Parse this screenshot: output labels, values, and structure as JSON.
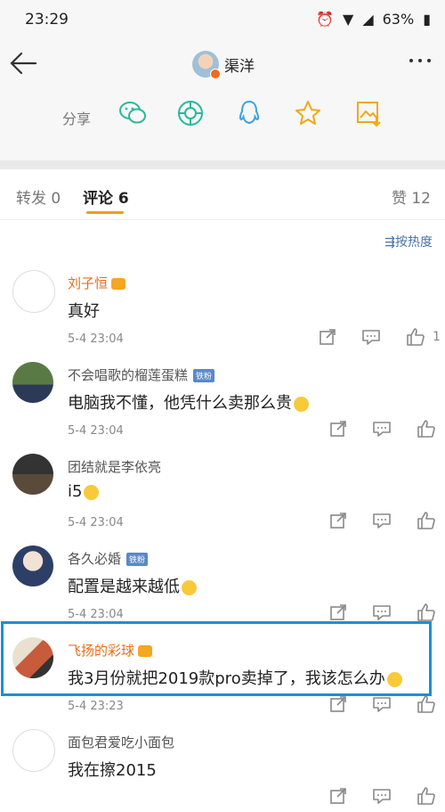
{
  "status": {
    "time": "23:29",
    "battery": "63%"
  },
  "header": {
    "title": "渠洋"
  },
  "share": {
    "label": "分享"
  },
  "tabs": {
    "repost": "转发 0",
    "comment": "评论 6",
    "likes": "赞 12"
  },
  "sort": {
    "label": "按热度"
  },
  "comments": [
    {
      "name": "刘子恒",
      "text": "真好",
      "time": "5-4 23:04",
      "likes": "1"
    },
    {
      "name": "不会唱歌的榴莲蛋糕",
      "text": "电脑我不懂，他凭什么卖那么贵",
      "time": "5-4 23:04",
      "likes": ""
    },
    {
      "name": "团结就是李依亮",
      "text": "i5",
      "time": "5-4 23:04",
      "likes": ""
    },
    {
      "name": "各久必婚",
      "text": "配置是越来越低",
      "time": "5-4 23:04",
      "likes": ""
    },
    {
      "name": "飞扬的彩球",
      "text": "我3月份就把2019款pro卖掉了，我该怎么办",
      "time": "5-4 23:23",
      "likes": ""
    },
    {
      "name": "面包君爱吃小面包",
      "text": "我在擦2015",
      "time": "",
      "likes": ""
    }
  ],
  "colors": {
    "accent": "#f39b1b",
    "highlight_box": "#1d8ed8",
    "vip_name": "#e86e1b",
    "link": "#4a74a6"
  }
}
